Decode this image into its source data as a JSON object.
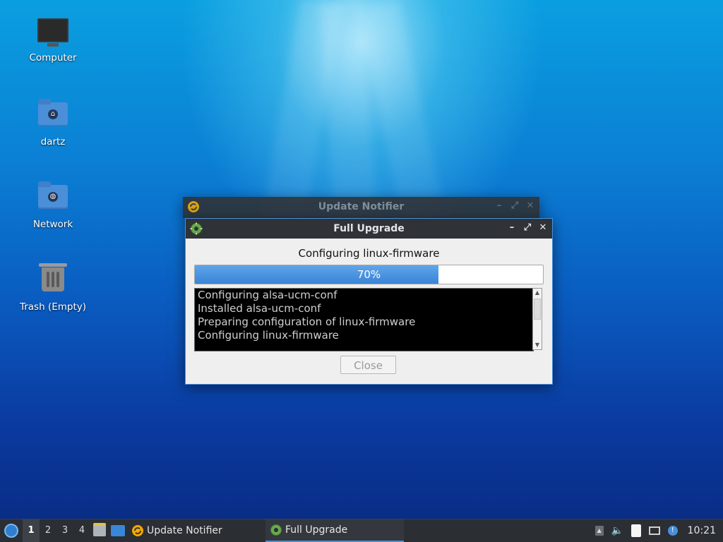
{
  "desktop": {
    "icons": [
      {
        "label": "Computer",
        "icon": "computer-icon"
      },
      {
        "label": "dartz",
        "icon": "home-folder-icon"
      },
      {
        "label": "Network",
        "icon": "network-folder-icon"
      },
      {
        "label": "Trash (Empty)",
        "icon": "trash-icon"
      }
    ]
  },
  "bg_window": {
    "title": "Update Notifier",
    "buttons": {
      "minimize": "–",
      "maximize": "⤢",
      "close": "✕"
    }
  },
  "dialog": {
    "title": "Full Upgrade",
    "buttons": {
      "minimize": "–",
      "maximize": "⤢",
      "close": "✕"
    },
    "status": "Configuring linux-firmware",
    "progress": {
      "value": 70,
      "label": "70%"
    },
    "log": [
      "Configuring alsa-ucm-conf",
      "Installed alsa-ucm-conf",
      "Preparing configuration of linux-firmware",
      "Configuring linux-firmware"
    ],
    "close_label": "Close"
  },
  "taskbar": {
    "workspaces": [
      "1",
      "2",
      "3",
      "4"
    ],
    "active_workspace": "1",
    "tasks": [
      {
        "label": "Update Notifier",
        "icon": "update-notifier-icon"
      },
      {
        "label": "Full Upgrade",
        "icon": "gear-icon"
      }
    ],
    "clock": "10:21"
  },
  "colors": {
    "accent": "#4a90d9",
    "progress_fill": "#3a84d6",
    "titlebar": "#2f3237"
  }
}
